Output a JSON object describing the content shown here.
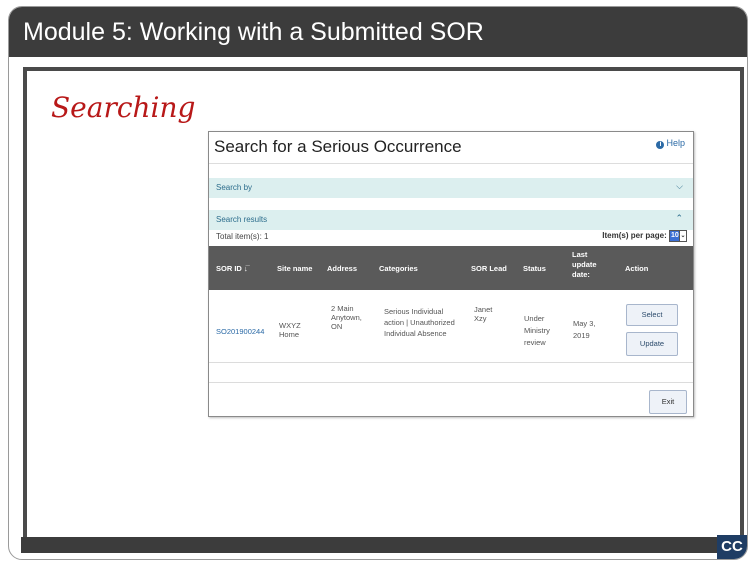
{
  "module_title": "Module 5:  Working with a Submitted SOR",
  "slide_heading": "Searching",
  "cc_label": "CC",
  "app": {
    "title": "Search for a Serious Occurrence",
    "help_icon": "i",
    "help_label": "Help",
    "search_by_label": "Search by",
    "search_results_label": "Search results",
    "total_items": "Total item(s): 1",
    "items_per_page_label": "Item(s) per page:",
    "items_per_page_value": "10",
    "columns": {
      "sor_id": "SOR ID",
      "sort_icon": "↓̅",
      "site_name": "Site name",
      "address": "Address",
      "categories": "Categories",
      "sor_lead": "SOR Lead",
      "status": "Status",
      "last_update_1": "Last",
      "last_update_2": "update",
      "last_update_3": "date:",
      "action": "Action"
    },
    "row": {
      "sor_id": "SO201900244",
      "site_name_1": "WXYZ",
      "site_name_2": "Home",
      "address_1": "2 Main",
      "address_2": "Anytown,",
      "address_3": "ON",
      "categories_1": "Serious Individual",
      "categories_2": "action | Unauthorized",
      "categories_3": "Individual Absence",
      "sor_lead_1": "Janet",
      "sor_lead_2": "Xzy",
      "status_1": "Under",
      "status_2": "Ministry",
      "status_3": "review",
      "last_update_1": "May 3,",
      "last_update_2": "2019",
      "select_label": "Select",
      "update_label": "Update"
    },
    "exit_label": "Exit"
  }
}
